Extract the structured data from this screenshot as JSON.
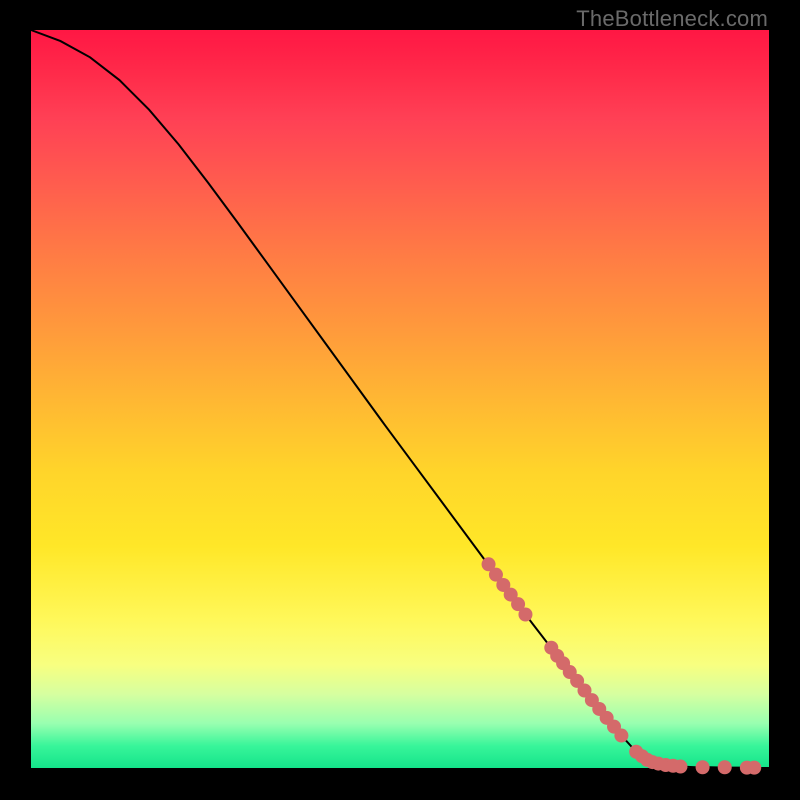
{
  "attribution": "TheBottleneck.com",
  "chart_data": {
    "type": "line",
    "title": "",
    "xlabel": "",
    "ylabel": "",
    "xlim": [
      0,
      100
    ],
    "ylim": [
      0,
      100
    ],
    "series": [
      {
        "name": "curve",
        "x": [
          0,
          4,
          8,
          12,
          16,
          20,
          24,
          28,
          32,
          36,
          40,
          44,
          48,
          52,
          56,
          60,
          64,
          68,
          72,
          76,
          80,
          82,
          84,
          86,
          88,
          90,
          92,
          94,
          96,
          98,
          100
        ],
        "y": [
          100,
          98.5,
          96.3,
          93.2,
          89.2,
          84.5,
          79.3,
          73.9,
          68.4,
          62.9,
          57.4,
          51.9,
          46.4,
          41.0,
          35.6,
          30.2,
          24.8,
          19.5,
          14.3,
          9.2,
          4.4,
          2.2,
          0.8,
          0.4,
          0.2,
          0.1,
          0.1,
          0.05,
          0.05,
          0.0,
          0.0
        ],
        "stroke": "#000000",
        "stroke_width": 2
      },
      {
        "name": "dot-cluster",
        "type": "scatter",
        "color": "#d46a6a",
        "radius": 7,
        "points": [
          {
            "x": 62.0,
            "y": 27.6
          },
          {
            "x": 63.0,
            "y": 26.2
          },
          {
            "x": 64.0,
            "y": 24.8
          },
          {
            "x": 65.0,
            "y": 23.5
          },
          {
            "x": 66.0,
            "y": 22.2
          },
          {
            "x": 67.0,
            "y": 20.8
          },
          {
            "x": 70.5,
            "y": 16.3
          },
          {
            "x": 71.3,
            "y": 15.2
          },
          {
            "x": 72.1,
            "y": 14.2
          },
          {
            "x": 73.0,
            "y": 13.0
          },
          {
            "x": 74.0,
            "y": 11.8
          },
          {
            "x": 75.0,
            "y": 10.5
          },
          {
            "x": 76.0,
            "y": 9.2
          },
          {
            "x": 77.0,
            "y": 8.0
          },
          {
            "x": 78.0,
            "y": 6.8
          },
          {
            "x": 79.0,
            "y": 5.6
          },
          {
            "x": 80.0,
            "y": 4.4
          },
          {
            "x": 82.0,
            "y": 2.2
          },
          {
            "x": 82.8,
            "y": 1.6
          },
          {
            "x": 83.5,
            "y": 1.1
          },
          {
            "x": 84.2,
            "y": 0.8
          },
          {
            "x": 85.0,
            "y": 0.6
          },
          {
            "x": 86.0,
            "y": 0.4
          },
          {
            "x": 87.0,
            "y": 0.3
          },
          {
            "x": 88.0,
            "y": 0.2
          },
          {
            "x": 91.0,
            "y": 0.1
          },
          {
            "x": 94.0,
            "y": 0.1
          },
          {
            "x": 97.0,
            "y": 0.05
          },
          {
            "x": 98.0,
            "y": 0.05
          }
        ]
      }
    ]
  }
}
